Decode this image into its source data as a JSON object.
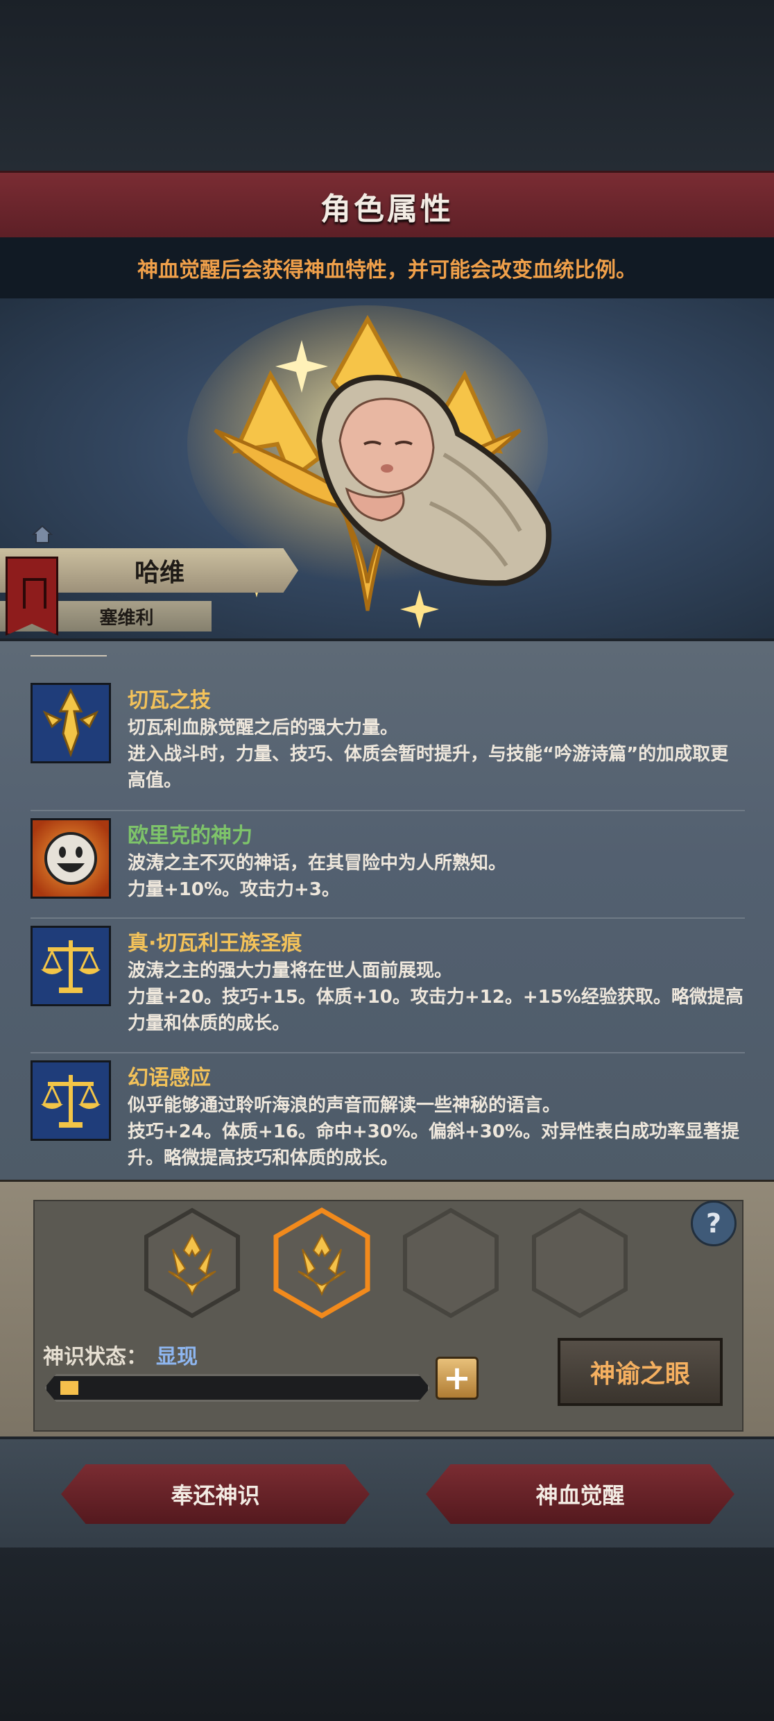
{
  "header": {
    "title": "角色属性",
    "notice": "神血觉醒后会获得神血特性，并可能会改变血统比例。"
  },
  "character": {
    "name": "哈维",
    "lineage": "塞维利"
  },
  "traits": [
    {
      "name": "切瓦之技",
      "name_color": "#f3c25a",
      "icon": "golden-sword-emblem-icon",
      "line1": "切瓦利血脉觉醒之后的强大力量。",
      "line2": "进入战斗时，力量、技巧、体质会暂时提升，与技能“吟游诗篇”的加成取更高值。"
    },
    {
      "name": "欧里克的神力",
      "name_color": "#7ec46a",
      "icon": "smiling-face-icon",
      "line1": "波涛之主不灭的神话，在其冒险中为人所熟知。",
      "line2": "力量+10%。攻击力+3。"
    },
    {
      "name": "真·切瓦利王族圣痕",
      "name_color": "#f3c25a",
      "icon": "golden-scales-icon",
      "line1": "波涛之主的强大力量将在世人面前展现。",
      "line2": "力量+20。技巧+15。体质+10。攻击力+12。+15%经验获取。略微提高力量和体质的成长。"
    },
    {
      "name": "幻语感应",
      "name_color": "#f3c25a",
      "icon": "golden-scales-icon",
      "line1": "似乎能够通过聆听海浪的声音而解读一些神秘的语言。",
      "line2": "技巧+24。体质+16。命中+30%。偏斜+30%。对异性表白成功率显著提升。略微提高技巧和体质的成长。"
    }
  ],
  "awakening": {
    "slots": [
      {
        "state": "filled"
      },
      {
        "state": "selected"
      },
      {
        "state": "empty"
      },
      {
        "state": "empty"
      }
    ],
    "state_label": "神识状态：",
    "state_value": "显现",
    "progress": 0.05,
    "oracle_label": "神谕之眼",
    "help_label": "?"
  },
  "actions": {
    "return_label": "奉还神识",
    "awaken_label": "神血觉醒"
  }
}
